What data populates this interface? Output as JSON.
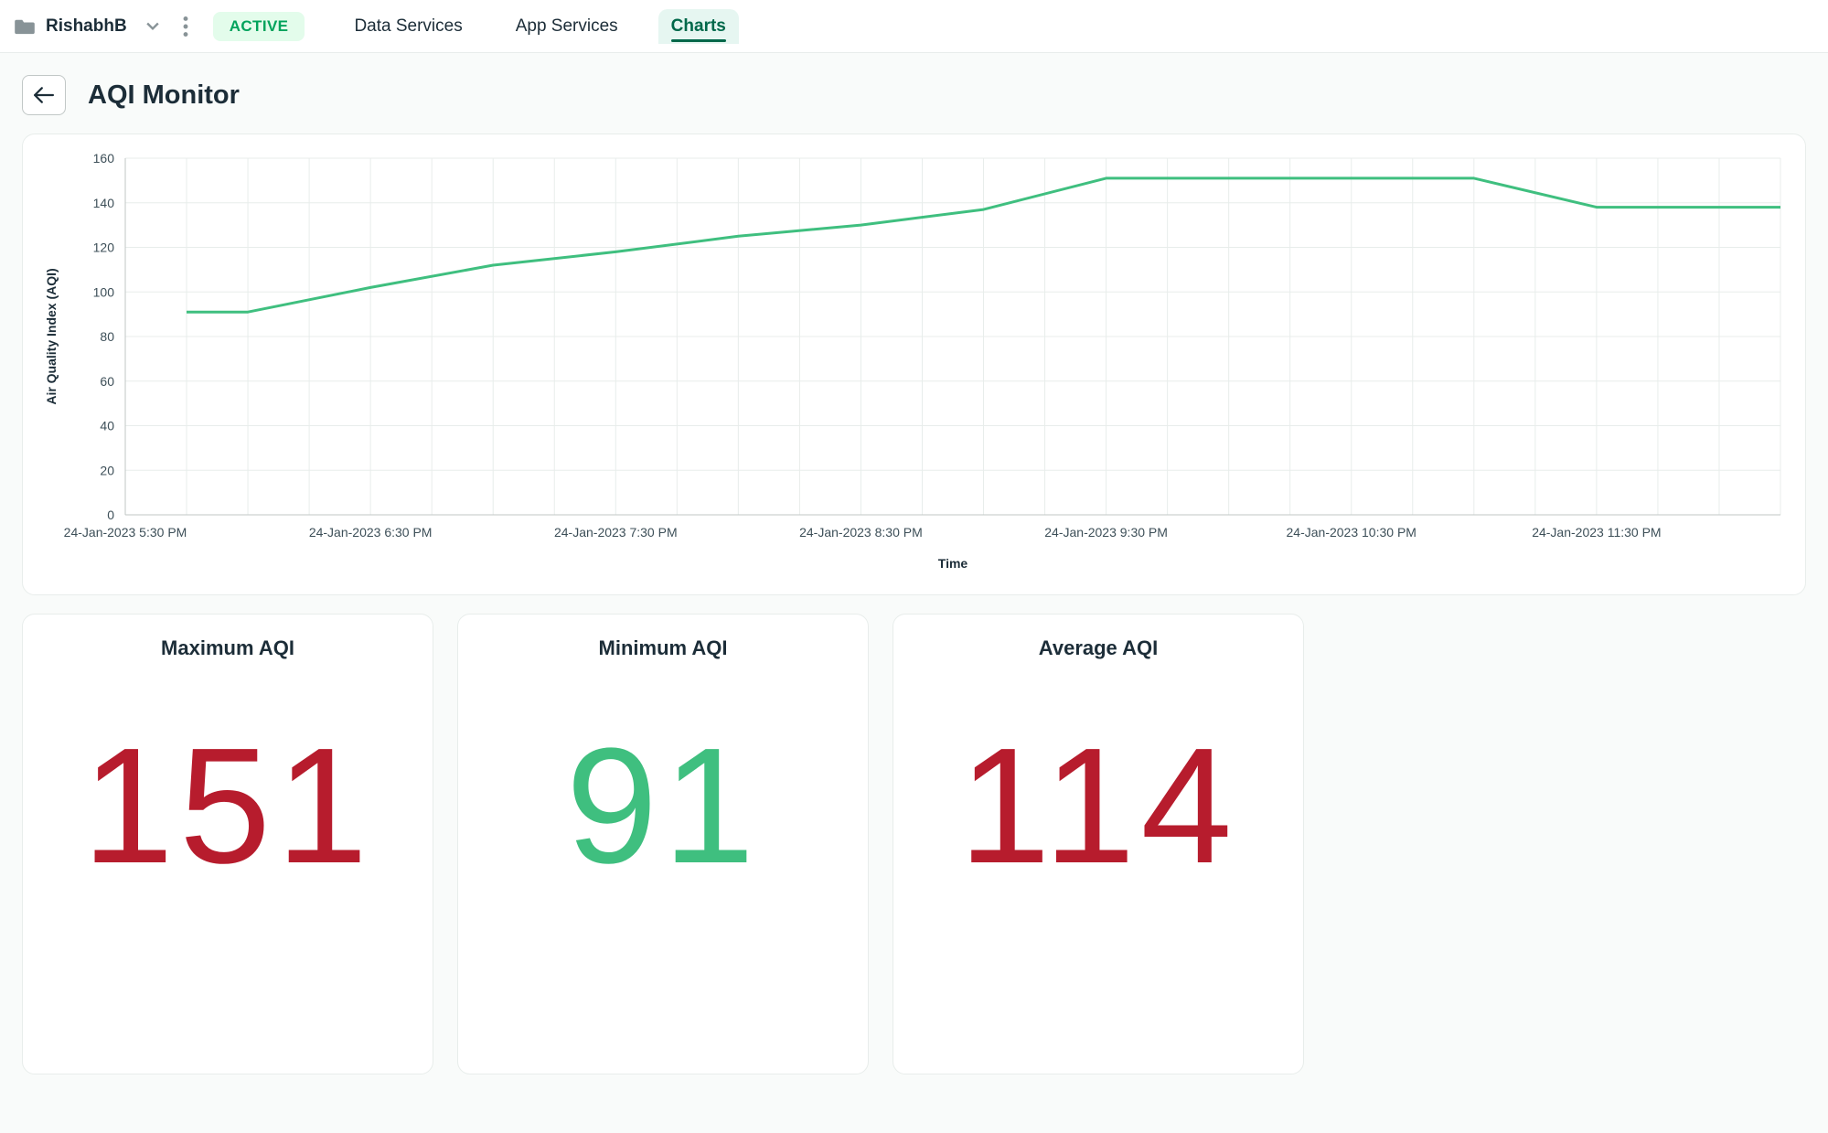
{
  "topbar": {
    "folder_name": "RishabhB",
    "status": "ACTIVE",
    "tabs": [
      {
        "label": "Data Services",
        "active": false
      },
      {
        "label": "App Services",
        "active": false
      },
      {
        "label": "Charts",
        "active": true
      }
    ]
  },
  "page": {
    "title": "AQI Monitor"
  },
  "chart_data": {
    "type": "line",
    "title": "",
    "xlabel": "Time",
    "ylabel": "Air Quality Index (AQI)",
    "ylim": [
      0,
      160
    ],
    "y_ticks": [
      0,
      20,
      40,
      60,
      80,
      100,
      120,
      140,
      160
    ],
    "x_tick_labels": [
      "24-Jan-2023 5:30 PM",
      "24-Jan-2023 6:30 PM",
      "24-Jan-2023 7:30 PM",
      "24-Jan-2023 8:30 PM",
      "24-Jan-2023 9:30 PM",
      "24-Jan-2023 10:30 PM",
      "24-Jan-2023 11:30 PM"
    ],
    "series": [
      {
        "name": "AQI",
        "color": "#3fbf7f",
        "x_hours": [
          5.75,
          6.0,
          6.5,
          7.0,
          7.5,
          8.0,
          8.5,
          9.0,
          9.5,
          10.5,
          11.0,
          11.5,
          12.0,
          12.25
        ],
        "values": [
          91,
          91,
          102,
          112,
          118,
          125,
          130,
          137,
          151,
          151,
          151,
          138,
          138,
          138
        ]
      }
    ],
    "x_domain_hours": [
      5.5,
      12.25
    ]
  },
  "stats": [
    {
      "title": "Maximum AQI",
      "value": "151",
      "cls": "stat-red"
    },
    {
      "title": "Minimum AQI",
      "value": "91",
      "cls": "stat-green"
    },
    {
      "title": "Average AQI",
      "value": "114",
      "cls": "stat-red"
    }
  ]
}
